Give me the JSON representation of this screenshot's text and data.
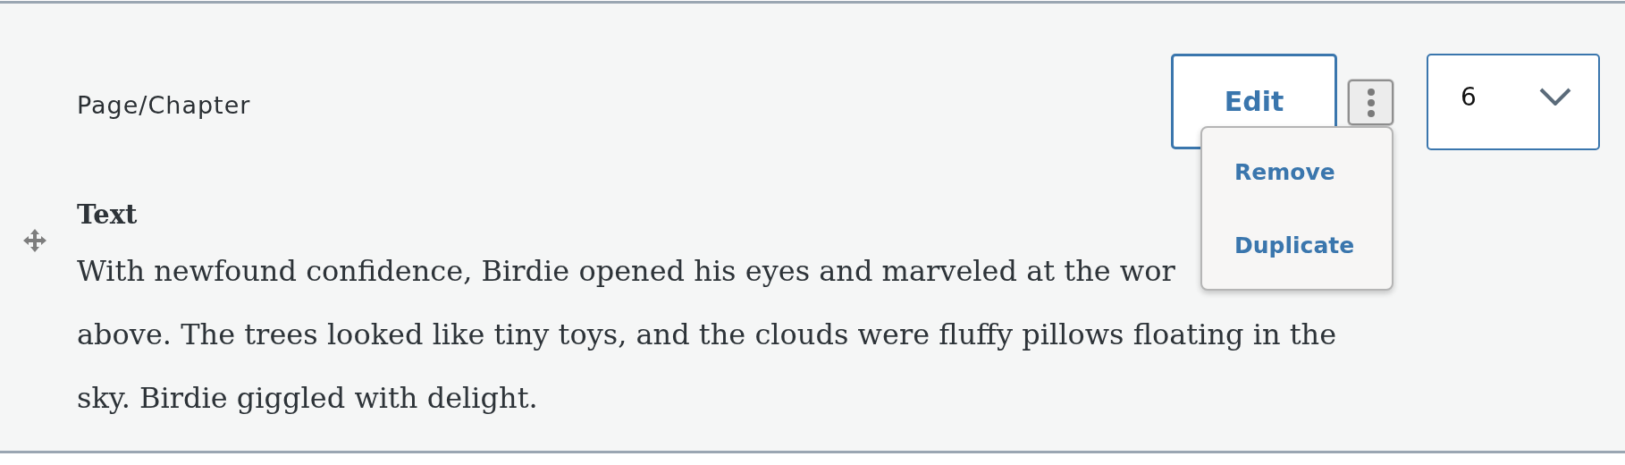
{
  "block_label": "Page/Chapter",
  "edit_button": "Edit",
  "more_menu": {
    "expanded": true,
    "items": [
      "Remove",
      "Duplicate"
    ]
  },
  "page_select": {
    "value": "6"
  },
  "text_block": {
    "heading": "Text",
    "lines": [
      "With newfound confidence, Birdie opened his eyes and marveled at the wor",
      "above. The trees looked like tiny toys, and the clouds were fluffy pillows floating in the",
      "sky. Birdie giggled with delight."
    ]
  }
}
